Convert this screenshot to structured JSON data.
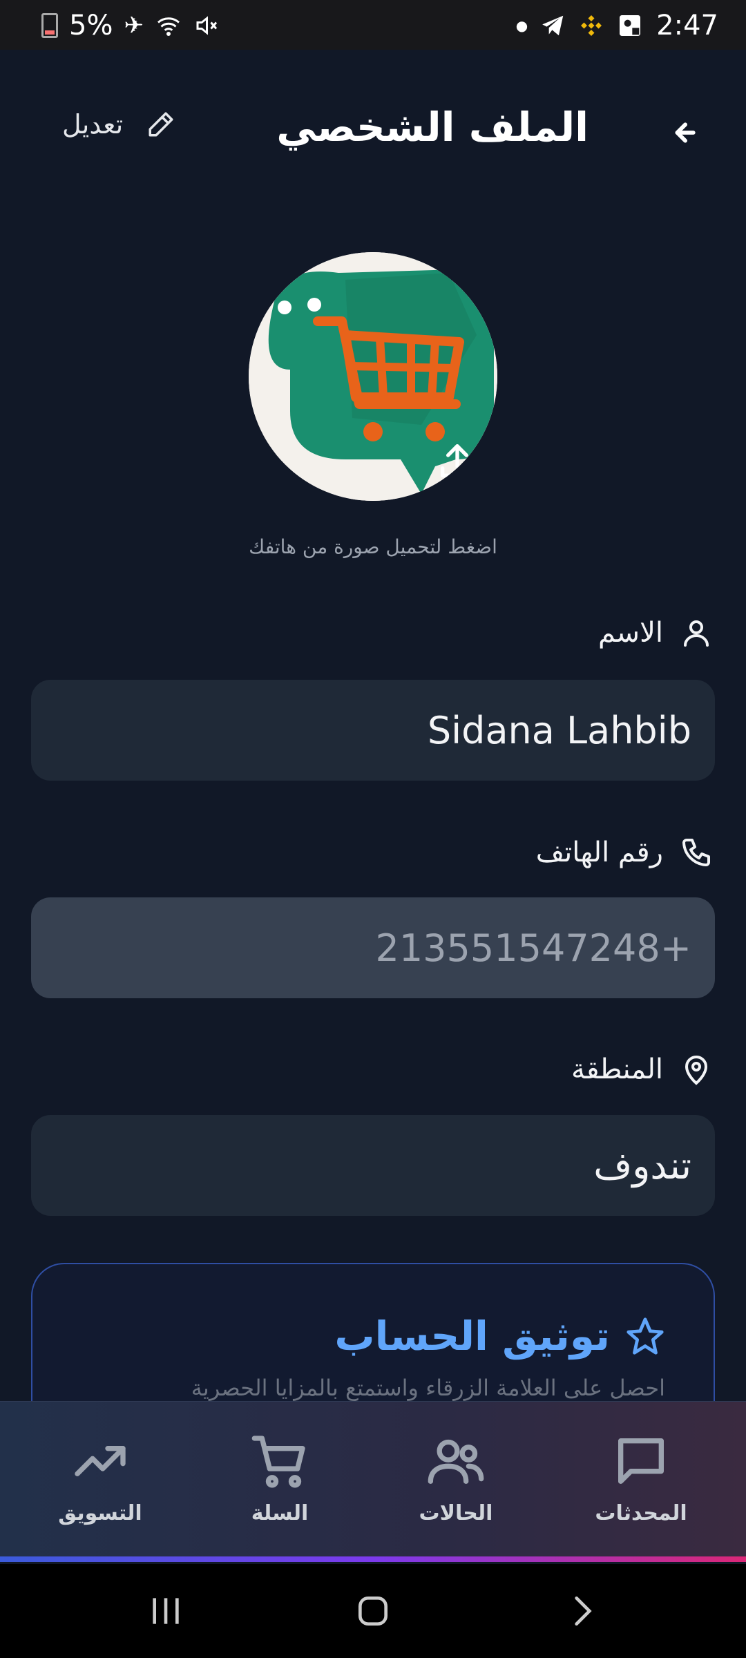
{
  "status_bar": {
    "battery": "5%",
    "time": "2:47"
  },
  "header": {
    "title": "الملف الشخصي",
    "edit_label": "تعديل"
  },
  "avatar": {
    "hint": "اضغط لتحميل صورة من هاتفك"
  },
  "fields": {
    "name": {
      "label": "الاسم",
      "value": "Sidana Lahbib"
    },
    "phone": {
      "label": "رقم الهاتف",
      "value": "213551547248+"
    },
    "region": {
      "label": "المنطقة",
      "value": "تندوف"
    }
  },
  "verification": {
    "title": "توثيق الحساب",
    "description": "احصل على العلامة الزرقاء واستمتع بالمزايا الحصرية"
  },
  "bottom_nav": {
    "items": [
      {
        "label": "التسويق",
        "icon": "trending-up-icon"
      },
      {
        "label": "السلة",
        "icon": "cart-icon"
      },
      {
        "label": "الحالات",
        "icon": "users-icon"
      },
      {
        "label": "المحدثات",
        "icon": "chat-icon"
      }
    ]
  },
  "colors": {
    "background": "#111827",
    "field": "#1f2937",
    "accent": "#60a5fa"
  }
}
